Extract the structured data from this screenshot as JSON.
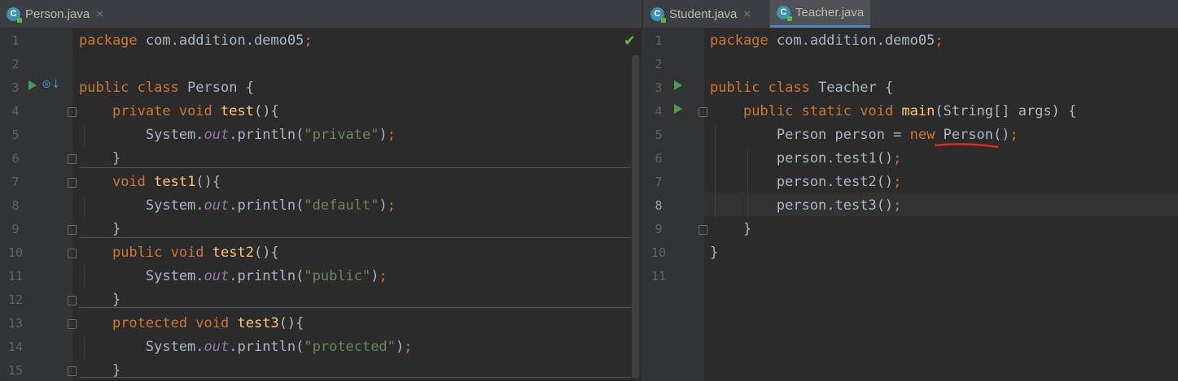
{
  "left_pane": {
    "tab": {
      "label": "Person.java",
      "icon": "java-class-icon",
      "close": "×"
    },
    "status_icon": "✔",
    "line_numbers": [
      "1",
      "2",
      "3",
      "4",
      "5",
      "6",
      "7",
      "8",
      "9",
      "10",
      "11",
      "12",
      "13",
      "14",
      "15"
    ],
    "code_lines": [
      [
        {
          "t": "package",
          "c": "kw"
        },
        {
          "t": " com.addition.demo05"
        },
        {
          "t": ";",
          "c": "kw"
        }
      ],
      [],
      [
        {
          "t": "public class",
          "c": "kw"
        },
        {
          "t": " Person {"
        }
      ],
      [
        {
          "t": "    "
        },
        {
          "t": "private void",
          "c": "kw"
        },
        {
          "t": " "
        },
        {
          "t": "test",
          "c": "fn"
        },
        {
          "t": "(){"
        }
      ],
      [
        {
          "t": "        System."
        },
        {
          "t": "out",
          "c": "fld"
        },
        {
          "t": ".println("
        },
        {
          "t": "\"private\"",
          "c": "str"
        },
        {
          "t": ")"
        },
        {
          "t": ";",
          "c": "kw"
        }
      ],
      [
        {
          "t": "    }"
        }
      ],
      [
        {
          "t": "    "
        },
        {
          "t": "void",
          "c": "kw"
        },
        {
          "t": " "
        },
        {
          "t": "test1",
          "c": "fn"
        },
        {
          "t": "(){"
        }
      ],
      [
        {
          "t": "        System."
        },
        {
          "t": "out",
          "c": "fld"
        },
        {
          "t": ".println("
        },
        {
          "t": "\"default\"",
          "c": "str"
        },
        {
          "t": ")"
        },
        {
          "t": ";",
          "c": "kw"
        }
      ],
      [
        {
          "t": "    }"
        }
      ],
      [
        {
          "t": "    "
        },
        {
          "t": "public void",
          "c": "kw"
        },
        {
          "t": " "
        },
        {
          "t": "test2",
          "c": "fn"
        },
        {
          "t": "(){"
        }
      ],
      [
        {
          "t": "        System."
        },
        {
          "t": "out",
          "c": "fld"
        },
        {
          "t": ".println("
        },
        {
          "t": "\"public\"",
          "c": "str"
        },
        {
          "t": ")"
        },
        {
          "t": ";",
          "c": "kw"
        }
      ],
      [
        {
          "t": "    }"
        }
      ],
      [
        {
          "t": "    "
        },
        {
          "t": "protected void",
          "c": "kw"
        },
        {
          "t": " "
        },
        {
          "t": "test3",
          "c": "fn"
        },
        {
          "t": "(){"
        }
      ],
      [
        {
          "t": "        System."
        },
        {
          "t": "out",
          "c": "fld"
        },
        {
          "t": ".println("
        },
        {
          "t": "\"protected\"",
          "c": "str"
        },
        {
          "t": ")"
        },
        {
          "t": ";",
          "c": "kw"
        }
      ],
      [
        {
          "t": "    }"
        }
      ]
    ]
  },
  "right_pane": {
    "tabs": [
      {
        "label": "Student.java",
        "icon": "java-class-icon",
        "close": "×",
        "active": false
      },
      {
        "label": "Teacher.java",
        "icon": "java-class-icon",
        "close": "",
        "active": true
      }
    ],
    "current_line": "8",
    "line_numbers": [
      "1",
      "2",
      "3",
      "4",
      "5",
      "6",
      "7",
      "8",
      "9",
      "10",
      "11"
    ],
    "code_lines": [
      [
        {
          "t": "package",
          "c": "kw"
        },
        {
          "t": " com.addition.demo05"
        },
        {
          "t": ";",
          "c": "kw"
        }
      ],
      [],
      [
        {
          "t": "public class",
          "c": "kw"
        },
        {
          "t": " Teacher {"
        }
      ],
      [
        {
          "t": "    "
        },
        {
          "t": "public static void",
          "c": "kw"
        },
        {
          "t": " "
        },
        {
          "t": "main",
          "c": "fn"
        },
        {
          "t": "(String[] args) {"
        }
      ],
      [
        {
          "t": "        Person person = "
        },
        {
          "t": "new",
          "c": "kw"
        },
        {
          "t": " Person()"
        },
        {
          "t": ";",
          "c": "kw"
        }
      ],
      [
        {
          "t": "        person.test1()"
        },
        {
          "t": ";",
          "c": "kw"
        }
      ],
      [
        {
          "t": "        person.test2()"
        },
        {
          "t": ";",
          "c": "kw"
        }
      ],
      [
        {
          "t": "        person.test3()"
        },
        {
          "t": ";",
          "c": "kw"
        }
      ],
      [
        {
          "t": "    }"
        }
      ],
      [
        {
          "t": "}"
        }
      ],
      []
    ]
  },
  "colors": {
    "background": "#2b2b2b",
    "keyword": "#cc7832",
    "function": "#ffc66d",
    "string": "#6a8759",
    "static_field": "#9876aa",
    "plain": "#a9b7c6",
    "annotation_underline": "#e0281e"
  }
}
